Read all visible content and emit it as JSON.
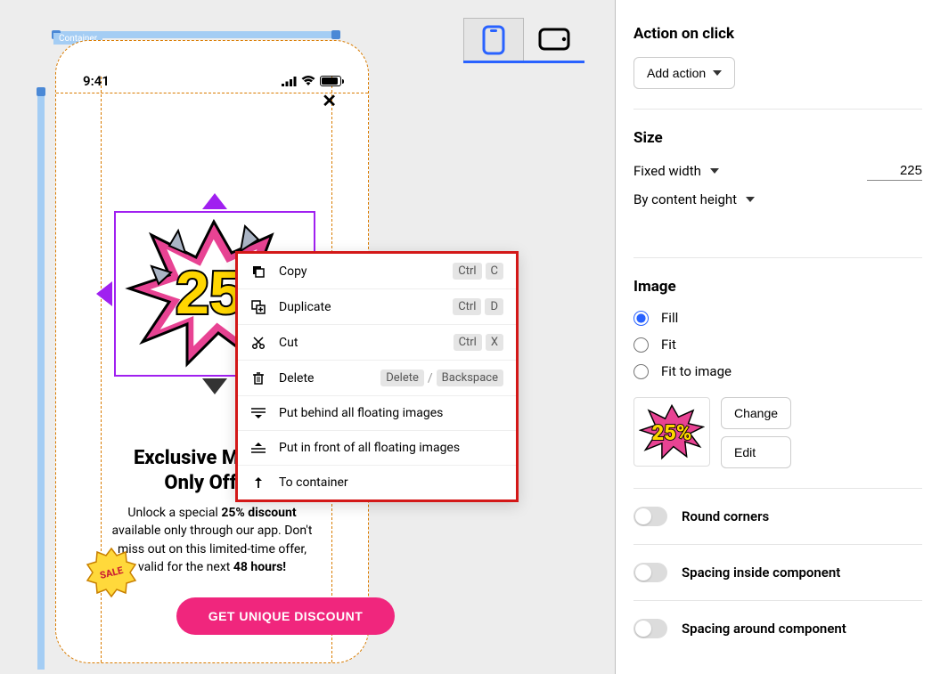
{
  "canvas": {
    "container_tag": "Container",
    "statusbar_time": "9:41",
    "close_glyph": "✕",
    "headline": "Exclusive Mobile-\nOnly Offer!",
    "body": "Unlock a special 25% discount available only through our app. Don't miss out on this limited-time offer, valid for the next 48 hours!",
    "cta_label": "GET UNIQUE DISCOUNT",
    "sale_badge": "SALE"
  },
  "context_menu": [
    {
      "icon": "copy",
      "label": "Copy",
      "keys": [
        "Ctrl",
        "C"
      ]
    },
    {
      "icon": "duplicate",
      "label": "Duplicate",
      "keys": [
        "Ctrl",
        "D"
      ]
    },
    {
      "icon": "cut",
      "label": "Cut",
      "keys": [
        "Ctrl",
        "X"
      ]
    },
    {
      "icon": "delete",
      "label": "Delete",
      "keys": [
        "Delete",
        "/",
        "Backspace"
      ]
    },
    {
      "icon": "behind",
      "label": "Put behind all floating images"
    },
    {
      "icon": "front",
      "label": "Put in front of all floating images"
    },
    {
      "icon": "tocontainer",
      "label": "To container"
    }
  ],
  "side": {
    "action_title": "Action on click",
    "add_action": "Add action",
    "size_title": "Size",
    "width_mode": "Fixed width",
    "width_value": "225",
    "height_mode": "By content height",
    "image_title": "Image",
    "image_modes": [
      "Fill",
      "Fit",
      "Fit to image"
    ],
    "image_selected": "Fill",
    "change_btn": "Change",
    "edit_btn": "Edit",
    "toggle_corners": "Round corners",
    "toggle_inside": "Spacing inside component",
    "toggle_around": "Spacing around component"
  }
}
